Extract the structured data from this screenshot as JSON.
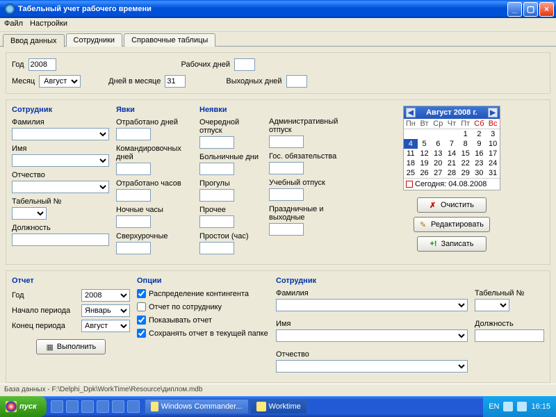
{
  "window": {
    "title": "Табельный учет рабочего времени"
  },
  "menu": {
    "file": "Файл",
    "settings": "Настройки"
  },
  "tabs": {
    "input": "Ввод данных",
    "employees": "Сотрудники",
    "ref": "Справочные таблицы"
  },
  "header": {
    "year_label": "Год",
    "year": "2008",
    "month_label": "Месяц",
    "month": "Август",
    "days_in_month_label": "Дней в месяце",
    "days_in_month": "31",
    "work_days_label": "Рабочих дней",
    "work_days": "",
    "off_days_label": "Выходных дней",
    "off_days": ""
  },
  "employee": {
    "title": "Сотрудник",
    "surname_label": "Фамилия",
    "surname": "",
    "name_label": "Имя",
    "name": "",
    "patronymic_label": "Отчество",
    "patronymic": "",
    "tabno_label": "Табельный №",
    "tabno": "",
    "position_label": "Должность",
    "position": ""
  },
  "attendance": {
    "title": "Явки",
    "worked_days_label": "Отработано дней",
    "worked_days": "",
    "trip_days_label": "Командировочных дней",
    "trip_days": "",
    "worked_hours_label": "Отработано часов",
    "worked_hours": "",
    "night_hours_label": "Ночные часы",
    "night_hours": "",
    "overtime_label": "Сверхурочные",
    "overtime": ""
  },
  "absence": {
    "title": "Неявки",
    "vacation_label": "Очередной отпуск",
    "vacation": "",
    "sick_label": "Больничные дни",
    "sick": "",
    "truancy_label": "Прогулы",
    "truancy": "",
    "other_label": "Прочее",
    "other": "",
    "idle_label": "Простои (час)",
    "idle": "",
    "admin_leave_label": "Административный отпуск",
    "admin_leave": "",
    "gov_label": "Гос. обязательства",
    "gov": "",
    "study_label": "Учебный отпуск",
    "study": "",
    "holidays_label": "Праздничные и выходные",
    "holidays": ""
  },
  "calendar": {
    "title": "Август 2008 г.",
    "days": [
      "Пн",
      "Вт",
      "Ср",
      "Чт",
      "Пт",
      "Сб",
      "Вс"
    ],
    "today_label": "Сегодня: 04.08.2008",
    "weeks": [
      [
        "",
        "",
        "",
        "",
        "1",
        "2",
        "3"
      ],
      [
        "4",
        "5",
        "6",
        "7",
        "8",
        "9",
        "10"
      ],
      [
        "11",
        "12",
        "13",
        "14",
        "15",
        "16",
        "17"
      ],
      [
        "18",
        "19",
        "20",
        "21",
        "22",
        "23",
        "24"
      ],
      [
        "25",
        "26",
        "27",
        "28",
        "29",
        "30",
        "31"
      ]
    ],
    "selected": "4"
  },
  "actions": {
    "clear": "Очистить",
    "edit": "Редактировать",
    "save": "Записать"
  },
  "report": {
    "title": "Отчет",
    "year_label": "Год",
    "year": "2008",
    "start_label": "Начало периода",
    "start": "Январь",
    "end_label": "Конец периода",
    "end": "Август",
    "execute": "Выполнить"
  },
  "options": {
    "title": "Опции",
    "distribution": "Распределение контингента",
    "by_employee": "Отчет по сотруднику",
    "show_report": "Показывать отчет",
    "save_in_folder": "Сохранять отчет в текущей папке",
    "distribution_checked": true,
    "by_employee_checked": false,
    "show_report_checked": true,
    "save_in_folder_checked": true
  },
  "report_employee": {
    "title": "Сотрудник",
    "surname_label": "Фамилия",
    "name_label": "Имя",
    "patronymic_label": "Отчество",
    "tabno_label": "Табельный №",
    "position_label": "Должность"
  },
  "status": "База данных - F:\\Delphi_Dpk\\WorkTime\\Resource\\диплом.mdb",
  "taskbar": {
    "start": "пуск",
    "task1": "Windows Commander...",
    "task2": "Worktime",
    "lang": "EN",
    "time": "16:15"
  }
}
